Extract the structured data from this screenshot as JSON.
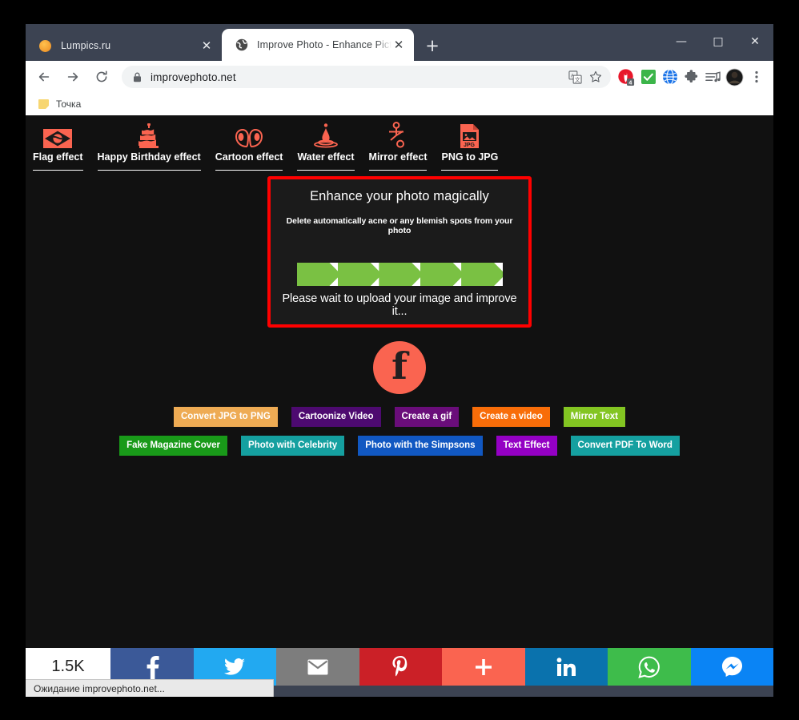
{
  "browser": {
    "tabs": [
      {
        "title": "Lumpics.ru",
        "favicon": "orange-circle-icon",
        "active": false
      },
      {
        "title": "Improve Photo - Enhance Picture",
        "favicon": "globe-icon",
        "active": true
      }
    ],
    "new_tab_label": "+",
    "window_controls": {
      "minimize": "—",
      "maximize": "□",
      "close": "✕"
    },
    "nav": {
      "back": "←",
      "forward": "→",
      "reload": "↻"
    },
    "omnibox": {
      "url": "improvephoto.net",
      "lock_icon": "lock-icon",
      "translate_icon": "translate-icon",
      "bookmark_icon": "star-icon"
    },
    "extensions": [
      {
        "name": "opera-vpn-icon",
        "badge": "4"
      },
      {
        "name": "checkmark-icon"
      },
      {
        "name": "globe-extension-icon"
      },
      {
        "name": "puzzle-piece-icon"
      },
      {
        "name": "media-playlist-icon"
      }
    ],
    "profile_icon": "avatar",
    "menu_icon": "three-dot-menu-icon",
    "bookmarks": [
      {
        "label": "Точка",
        "icon": "folder-icon"
      }
    ],
    "status_text": "Ожидание improvephoto.net..."
  },
  "site": {
    "effects": [
      {
        "label": "Flag effect",
        "icon": "flag-icon"
      },
      {
        "label": "Happy Birthday effect",
        "icon": "birthday-cake-icon"
      },
      {
        "label": "Cartoon effect",
        "icon": "cartoon-eyes-icon"
      },
      {
        "label": "Water effect",
        "icon": "water-drop-icon"
      },
      {
        "label": "Mirror effect",
        "icon": "mirror-icon"
      },
      {
        "label": "PNG to JPG",
        "icon": "jpg-file-icon"
      }
    ],
    "hero": {
      "title": "Enhance your photo magically",
      "subtitle": "Delete automatically acne or any blemish spots from your photo",
      "status": "Please wait to upload your image and improve it...",
      "border_color": "#ff0000",
      "progress": {
        "value": 100,
        "chevron_color": "#7ac143",
        "track_color": "#ffffff",
        "segments": 5
      }
    },
    "facebook_badge": {
      "icon": "facebook-f-icon",
      "color": "#fa6450"
    },
    "links_row1": [
      {
        "label": "Convert JPG to PNG",
        "color": "#eeab54"
      },
      {
        "label": "Cartoonize Video",
        "color": "#4d0a70"
      },
      {
        "label": "Create a gif",
        "color": "#6a0d7a"
      },
      {
        "label": "Create a video",
        "color": "#f86d09"
      },
      {
        "label": "Mirror Text",
        "color": "#83c522"
      }
    ],
    "links_row2": [
      {
        "label": "Fake Magazine Cover",
        "color": "#199a19"
      },
      {
        "label": "Photo with Celebrity",
        "color": "#15a0a0"
      },
      {
        "label": "Photo with the Simpsons",
        "color": "#1158c2"
      },
      {
        "label": "Text Effect",
        "color": "#9400c4"
      },
      {
        "label": "Convert PDF To Word",
        "color": "#15a0a0"
      }
    ],
    "share_bar": {
      "count": "1.5K",
      "buttons": [
        {
          "name": "facebook-share-button",
          "icon": "facebook-f-icon",
          "color": "#3b5998"
        },
        {
          "name": "twitter-share-button",
          "icon": "twitter-bird-icon",
          "color": "#22a9f1"
        },
        {
          "name": "email-share-button",
          "icon": "envelope-icon",
          "color": "#7d7d7d"
        },
        {
          "name": "pinterest-share-button",
          "icon": "pinterest-p-icon",
          "color": "#cb2027"
        },
        {
          "name": "more-share-button",
          "icon": "plus-icon",
          "color": "#fa6450"
        },
        {
          "name": "linkedin-share-button",
          "icon": "linkedin-in-icon",
          "color": "#0a72ad"
        },
        {
          "name": "whatsapp-share-button",
          "icon": "whatsapp-icon",
          "color": "#3ebc4b"
        },
        {
          "name": "messenger-share-button",
          "icon": "messenger-icon",
          "color": "#0a84f5"
        }
      ]
    }
  }
}
